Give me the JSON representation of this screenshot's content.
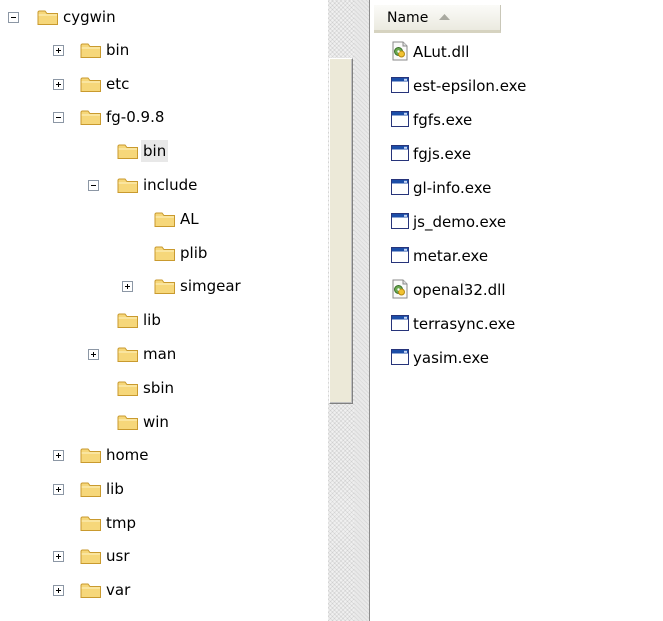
{
  "tree": {
    "nodes": [
      {
        "label": "cygwin",
        "expander": "minus"
      },
      {
        "label": "bin",
        "expander": "plus"
      },
      {
        "label": "etc",
        "expander": "plus"
      },
      {
        "label": "fg-0.9.8",
        "expander": "minus"
      },
      {
        "label": "bin",
        "expander": "none",
        "selected": true
      },
      {
        "label": "include",
        "expander": "minus"
      },
      {
        "label": "AL",
        "expander": "none"
      },
      {
        "label": "plib",
        "expander": "none"
      },
      {
        "label": "simgear",
        "expander": "plus"
      },
      {
        "label": "lib",
        "expander": "none"
      },
      {
        "label": "man",
        "expander": "plus"
      },
      {
        "label": "sbin",
        "expander": "none"
      },
      {
        "label": "win",
        "expander": "none"
      },
      {
        "label": "home",
        "expander": "plus"
      },
      {
        "label": "lib",
        "expander": "plus"
      },
      {
        "label": "tmp",
        "expander": "none"
      },
      {
        "label": "usr",
        "expander": "plus"
      },
      {
        "label": "var",
        "expander": "plus"
      }
    ]
  },
  "file_list": {
    "column_header": "Name",
    "sort_direction": "ascending",
    "files": [
      {
        "name": "ALut.dll",
        "icon": "dll-icon"
      },
      {
        "name": "est-epsilon.exe",
        "icon": "exe-icon"
      },
      {
        "name": "fgfs.exe",
        "icon": "exe-icon"
      },
      {
        "name": "fgjs.exe",
        "icon": "exe-icon"
      },
      {
        "name": "gl-info.exe",
        "icon": "exe-icon"
      },
      {
        "name": "js_demo.exe",
        "icon": "exe-icon"
      },
      {
        "name": "metar.exe",
        "icon": "exe-icon"
      },
      {
        "name": "openal32.dll",
        "icon": "dll-icon"
      },
      {
        "name": "terrasync.exe",
        "icon": "exe-icon"
      },
      {
        "name": "yasim.exe",
        "icon": "exe-icon"
      }
    ]
  },
  "colors": {
    "folder_fill": "#f6d77a",
    "folder_stroke": "#c99a2e",
    "selection_bg": "#e8e8e8",
    "exe_titlebar": "#1c4ea8"
  }
}
